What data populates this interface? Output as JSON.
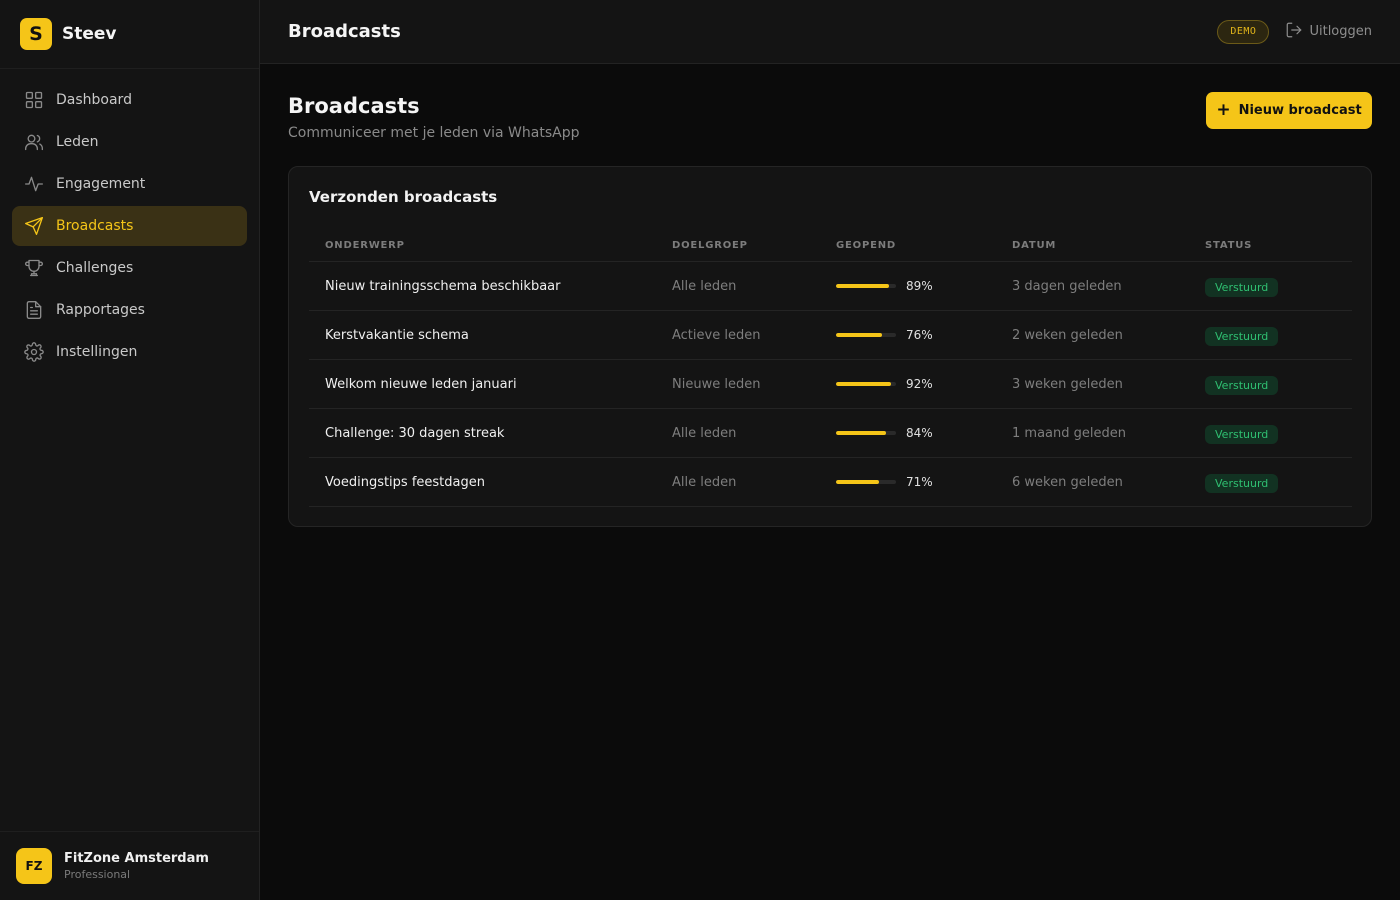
{
  "brand": {
    "logo_letter": "S",
    "name": "Steev"
  },
  "sidebar": {
    "items": [
      {
        "label": "Dashboard",
        "icon": "grid-icon",
        "active": false
      },
      {
        "label": "Leden",
        "icon": "users-icon",
        "active": false
      },
      {
        "label": "Engagement",
        "icon": "activity-icon",
        "active": false
      },
      {
        "label": "Broadcasts",
        "icon": "send-icon",
        "active": true
      },
      {
        "label": "Challenges",
        "icon": "trophy-icon",
        "active": false
      },
      {
        "label": "Rapportages",
        "icon": "file-icon",
        "active": false
      },
      {
        "label": "Instellingen",
        "icon": "gear-icon",
        "active": false
      }
    ]
  },
  "org": {
    "initials": "FZ",
    "name": "FitZone Amsterdam",
    "plan": "Professional"
  },
  "header": {
    "title": "Broadcasts",
    "badge": "DEMO",
    "logout_label": "Uitloggen"
  },
  "page": {
    "title": "Broadcasts",
    "subtitle": "Communiceer met je leden via WhatsApp",
    "new_button_label": "Nieuw broadcast"
  },
  "table": {
    "title": "Verzonden broadcasts",
    "columns": [
      "ONDERWERP",
      "DOELGROEP",
      "GEOPEND",
      "DATUM",
      "STATUS"
    ],
    "rows": [
      {
        "subject": "Nieuw trainingsschema beschikbaar",
        "group": "Alle leden",
        "opened": 89,
        "opened_label": "89%",
        "date": "3 dagen geleden",
        "status": "Verstuurd"
      },
      {
        "subject": "Kerstvakantie schema",
        "group": "Actieve leden",
        "opened": 76,
        "opened_label": "76%",
        "date": "2 weken geleden",
        "status": "Verstuurd"
      },
      {
        "subject": "Welkom nieuwe leden januari",
        "group": "Nieuwe leden",
        "opened": 92,
        "opened_label": "92%",
        "date": "3 weken geleden",
        "status": "Verstuurd"
      },
      {
        "subject": "Challenge: 30 dagen streak",
        "group": "Alle leden",
        "opened": 84,
        "opened_label": "84%",
        "date": "1 maand geleden",
        "status": "Verstuurd"
      },
      {
        "subject": "Voedingstips feestdagen",
        "group": "Alle leden",
        "opened": 71,
        "opened_label": "71%",
        "date": "6 weken geleden",
        "status": "Verstuurd"
      }
    ]
  },
  "colors": {
    "accent": "#f5c518",
    "status_green": "#2fbf71",
    "background": "#0b0b0b"
  }
}
